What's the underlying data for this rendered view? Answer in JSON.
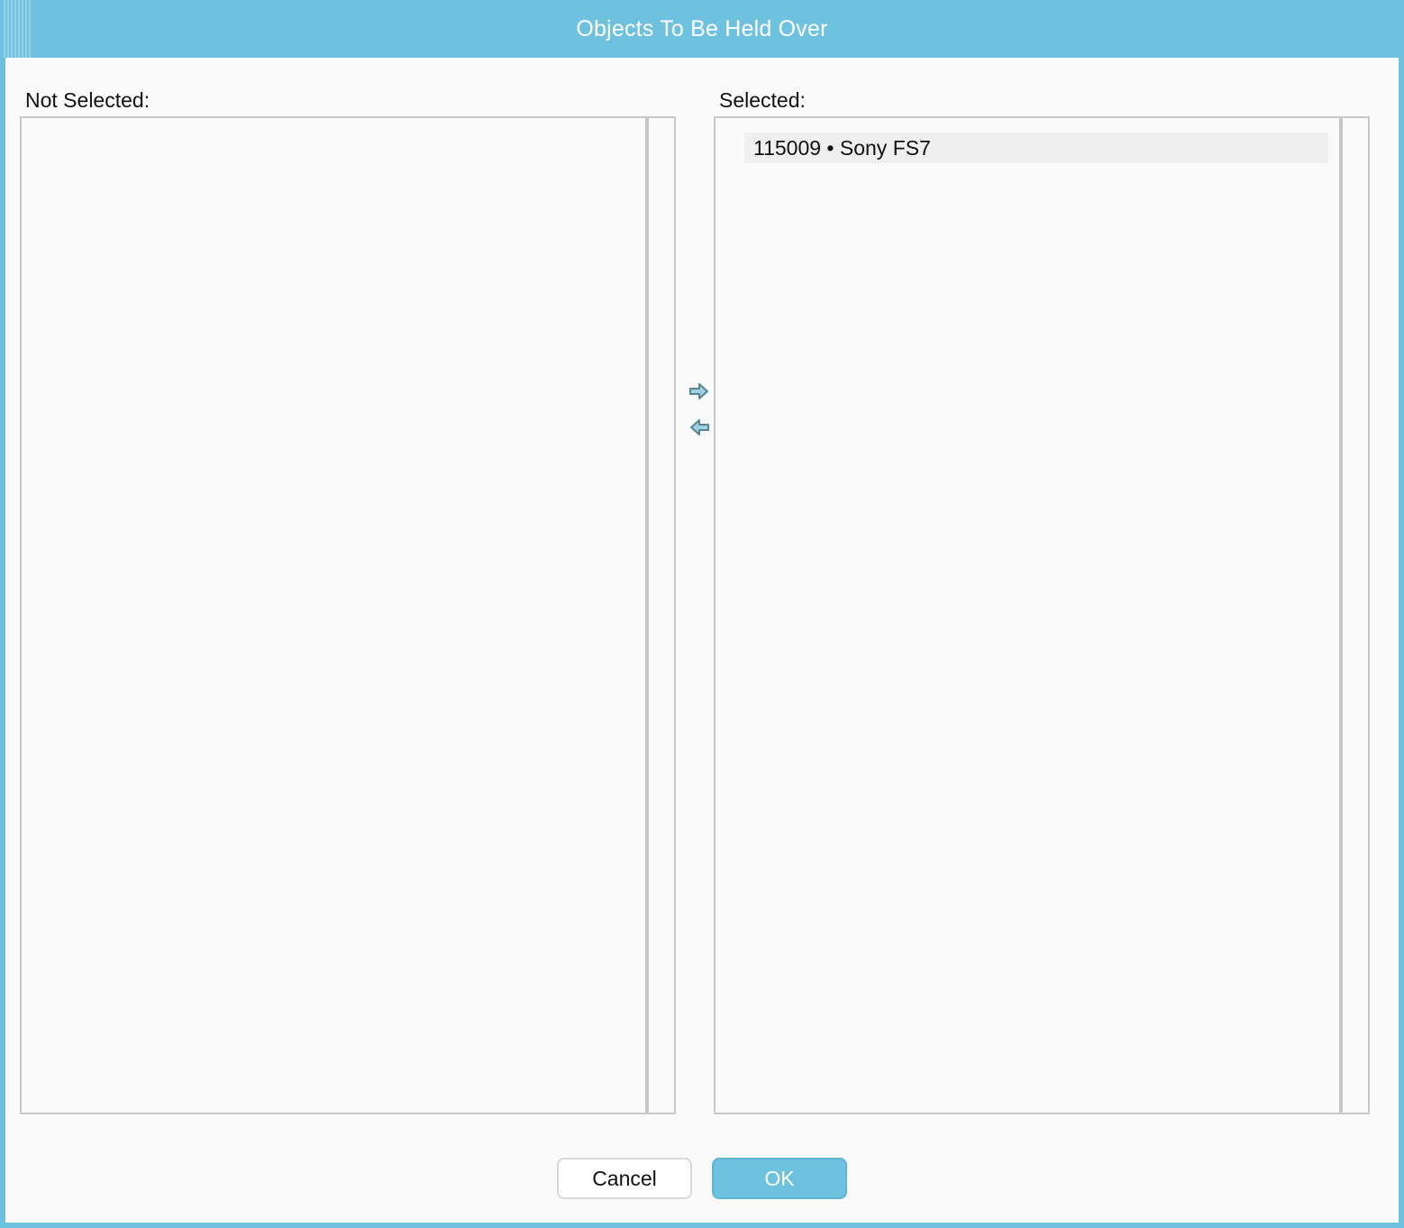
{
  "dialog": {
    "title": "Objects To Be Held Over"
  },
  "lists": {
    "not_selected": {
      "label": "Not Selected:",
      "items": []
    },
    "selected": {
      "label": "Selected:",
      "items": [
        {
          "text": "115009 • Sony FS7"
        }
      ]
    }
  },
  "arrows": {
    "move_right_icon": "arrow-right-icon",
    "move_left_icon": "arrow-left-icon"
  },
  "buttons": {
    "cancel": "Cancel",
    "ok": "OK"
  },
  "colors": {
    "accent": "#6fc2df",
    "background": "#fafafa",
    "border": "#c9c9c9"
  }
}
